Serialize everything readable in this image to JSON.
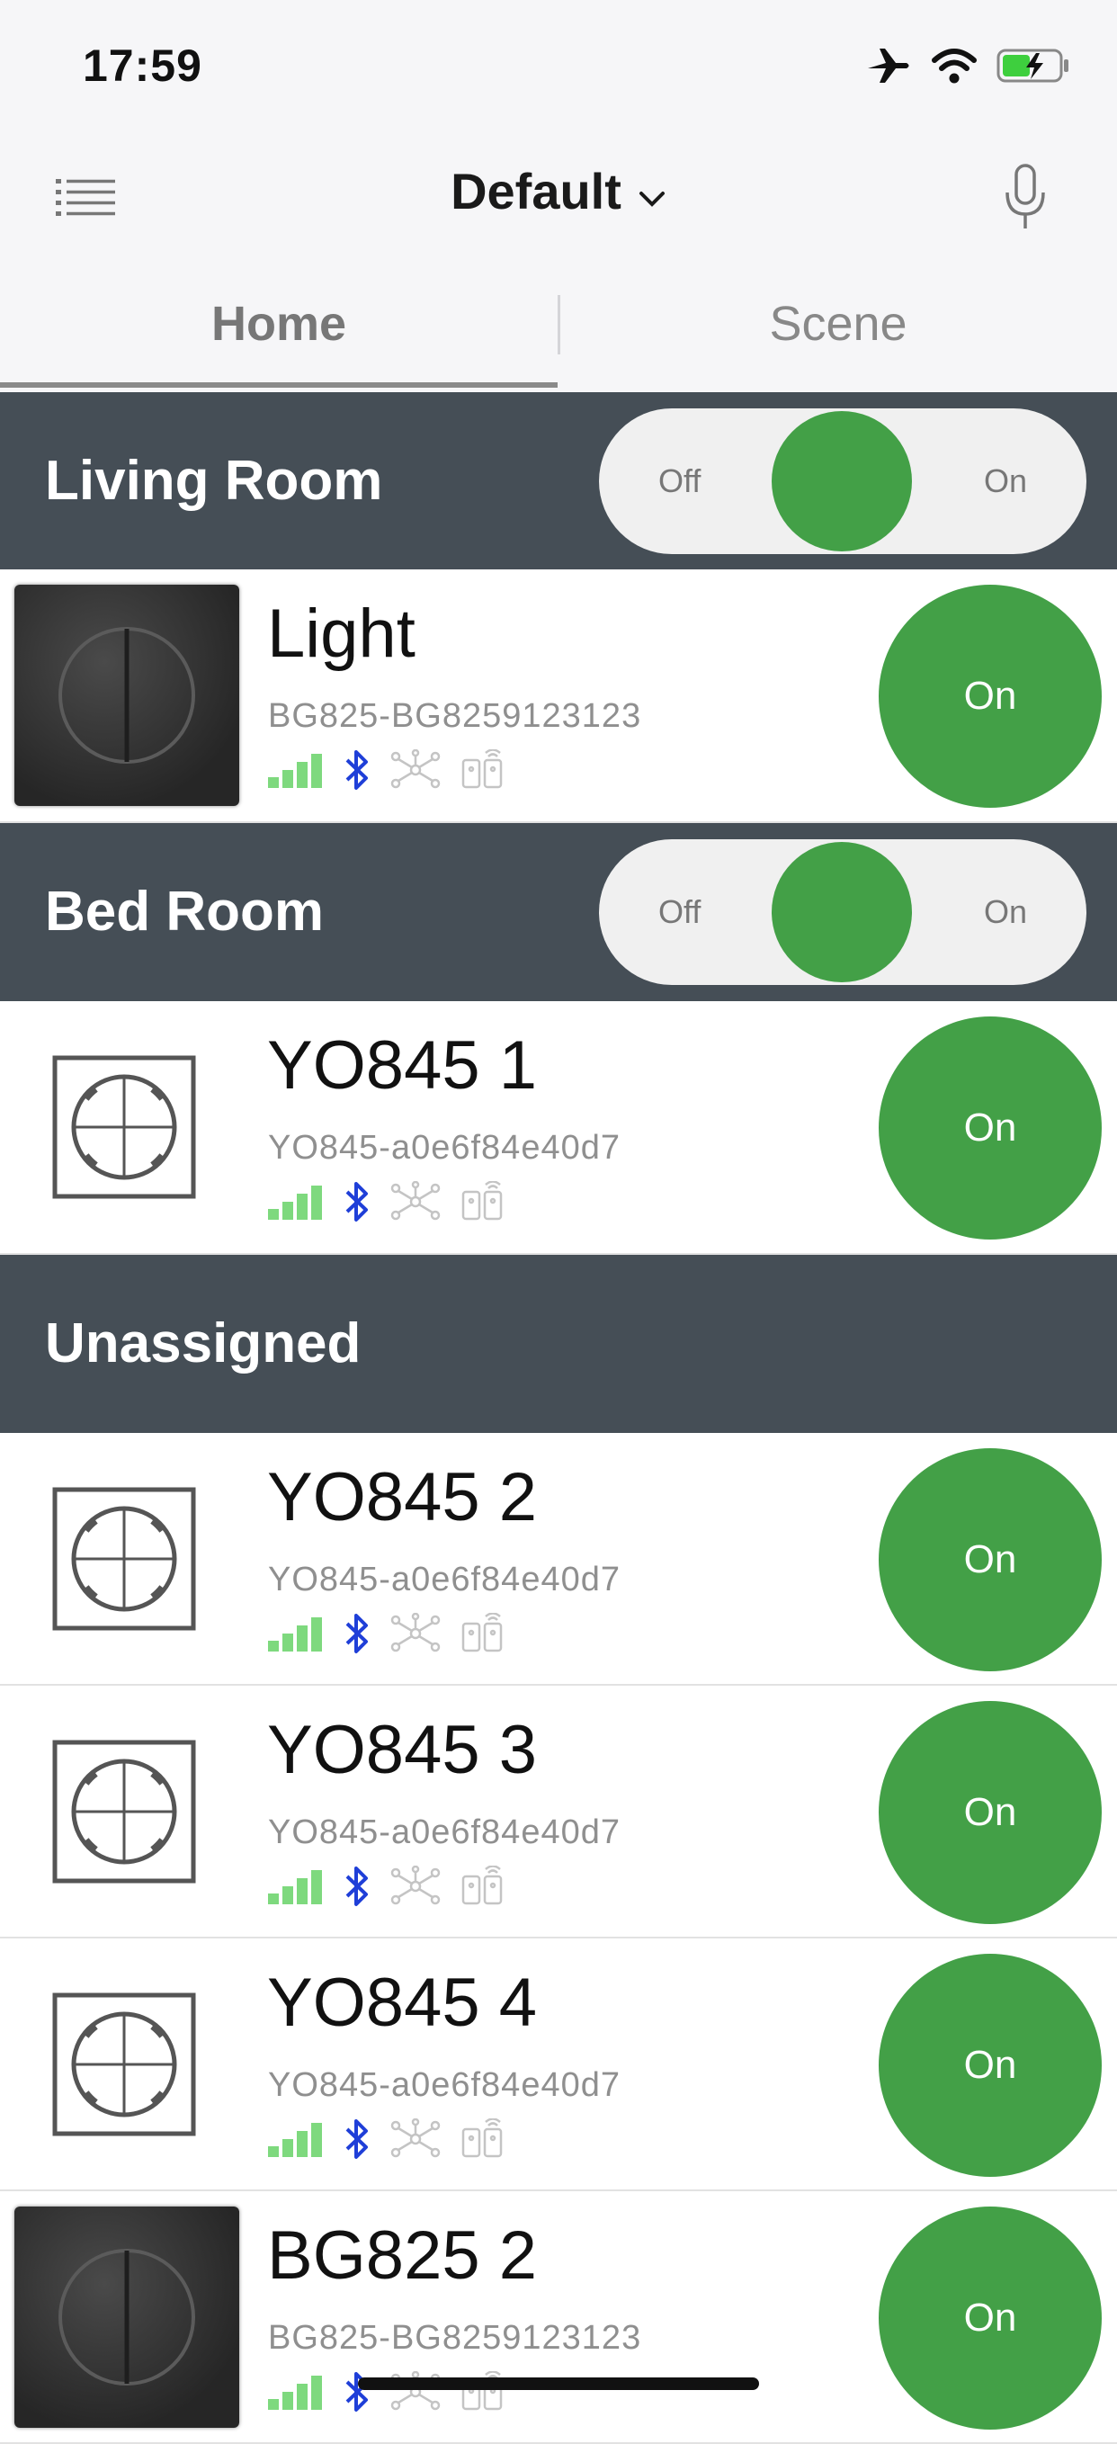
{
  "status_bar": {
    "time": "17:59"
  },
  "header": {
    "title": "Default"
  },
  "tabs": [
    {
      "label": "Home",
      "active": true
    },
    {
      "label": "Scene",
      "active": false
    }
  ],
  "colors": {
    "accent_green": "#43a047",
    "section_bg": "#454e56",
    "bluetooth_blue": "#1f3fd8",
    "signal_green": "#7ed97e"
  },
  "sections": [
    {
      "title": "Living Room",
      "toggle": {
        "off_label": "Off",
        "on_label": "On"
      },
      "devices": [
        {
          "name": "Light",
          "id": "BG825-BG8259123123",
          "button_label": "On",
          "thumb": "dark-switch-icon"
        }
      ]
    },
    {
      "title": "Bed Room",
      "toggle": {
        "off_label": "Off",
        "on_label": "On"
      },
      "devices": [
        {
          "name": "YO845 1",
          "id": "YO845-a0e6f84e40d7",
          "button_label": "On",
          "thumb": "outline-switch-icon"
        }
      ]
    },
    {
      "title": "Unassigned",
      "devices": [
        {
          "name": "YO845 2",
          "id": "YO845-a0e6f84e40d7",
          "button_label": "On",
          "thumb": "outline-switch-icon"
        },
        {
          "name": "YO845 3",
          "id": "YO845-a0e6f84e40d7",
          "button_label": "On",
          "thumb": "outline-switch-icon"
        },
        {
          "name": "YO845 4",
          "id": "YO845-a0e6f84e40d7",
          "button_label": "On",
          "thumb": "outline-switch-icon"
        },
        {
          "name": "BG825 2",
          "id": "BG825-BG8259123123",
          "button_label": "On",
          "thumb": "dark-switch-icon"
        }
      ]
    }
  ]
}
